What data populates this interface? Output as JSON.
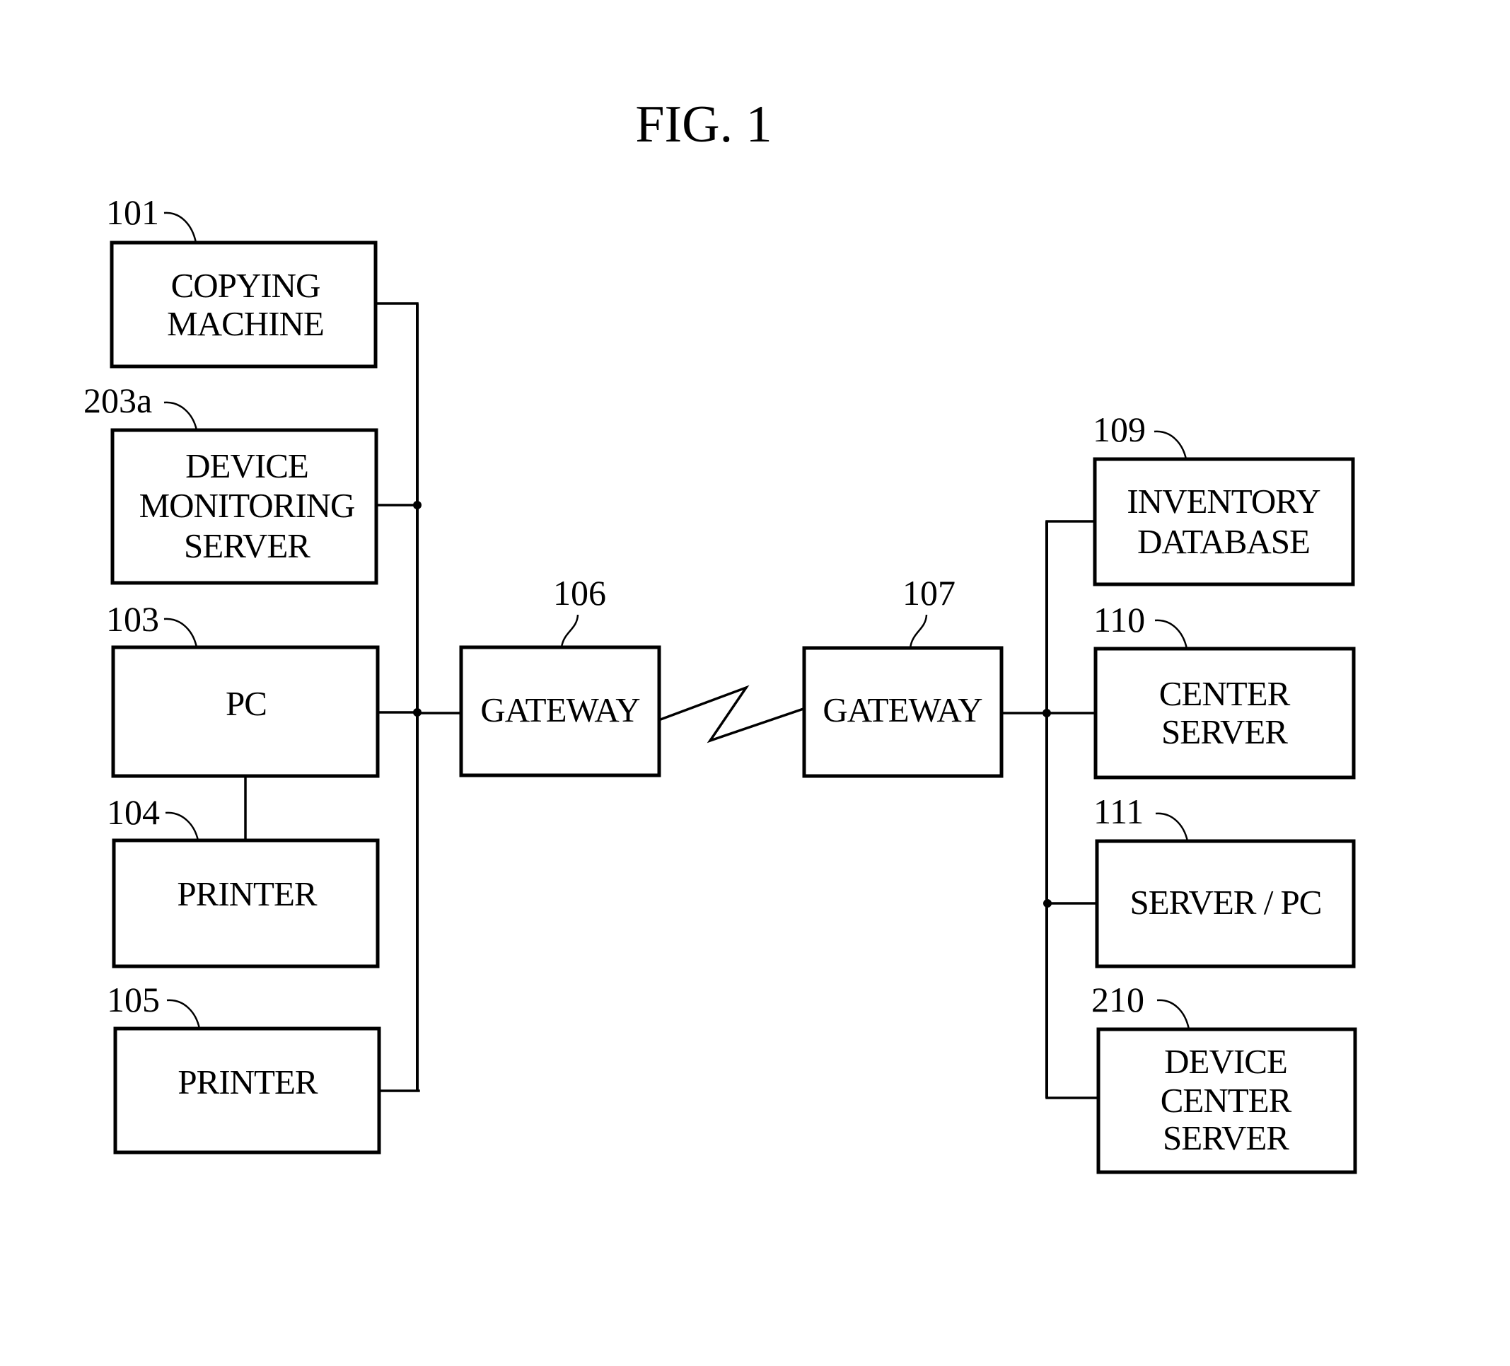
{
  "figure": {
    "title": "FIG. 1"
  },
  "left_network": {
    "nodes": [
      {
        "id": "copying-machine",
        "ref": "101",
        "lines": [
          "COPYING",
          "MACHINE"
        ]
      },
      {
        "id": "device-monitoring-server",
        "ref": "203a",
        "lines": [
          "DEVICE",
          "MONITORING",
          "SERVER"
        ]
      },
      {
        "id": "pc",
        "ref": "103",
        "lines": [
          "PC"
        ]
      },
      {
        "id": "printer-104",
        "ref": "104",
        "lines": [
          "PRINTER"
        ]
      },
      {
        "id": "printer-105",
        "ref": "105",
        "lines": [
          "PRINTER"
        ]
      }
    ]
  },
  "gateways": [
    {
      "id": "gateway-106",
      "ref": "106",
      "lines": [
        "GATEWAY"
      ]
    },
    {
      "id": "gateway-107",
      "ref": "107",
      "lines": [
        "GATEWAY"
      ]
    }
  ],
  "right_network": {
    "nodes": [
      {
        "id": "inventory-database",
        "ref": "109",
        "lines": [
          "INVENTORY",
          "DATABASE"
        ]
      },
      {
        "id": "center-server",
        "ref": "110",
        "lines": [
          "CENTER",
          "SERVER"
        ]
      },
      {
        "id": "server-pc",
        "ref": "111",
        "lines": [
          "SERVER / PC"
        ]
      },
      {
        "id": "device-center-server",
        "ref": "210",
        "lines": [
          "DEVICE",
          "CENTER",
          "SERVER"
        ]
      }
    ]
  },
  "connections": [
    {
      "from": "copying-machine",
      "to": "left-bus"
    },
    {
      "from": "device-monitoring-server",
      "to": "left-bus"
    },
    {
      "from": "pc",
      "to": "left-bus"
    },
    {
      "from": "pc",
      "to": "printer-104"
    },
    {
      "from": "printer-105",
      "to": "left-bus"
    },
    {
      "from": "left-bus",
      "to": "gateway-106"
    },
    {
      "from": "gateway-106",
      "to": "gateway-107",
      "kind": "wireless-link"
    },
    {
      "from": "gateway-107",
      "to": "right-bus"
    },
    {
      "from": "inventory-database",
      "to": "right-bus"
    },
    {
      "from": "center-server",
      "to": "right-bus"
    },
    {
      "from": "server-pc",
      "to": "right-bus"
    },
    {
      "from": "device-center-server",
      "to": "right-bus"
    }
  ]
}
